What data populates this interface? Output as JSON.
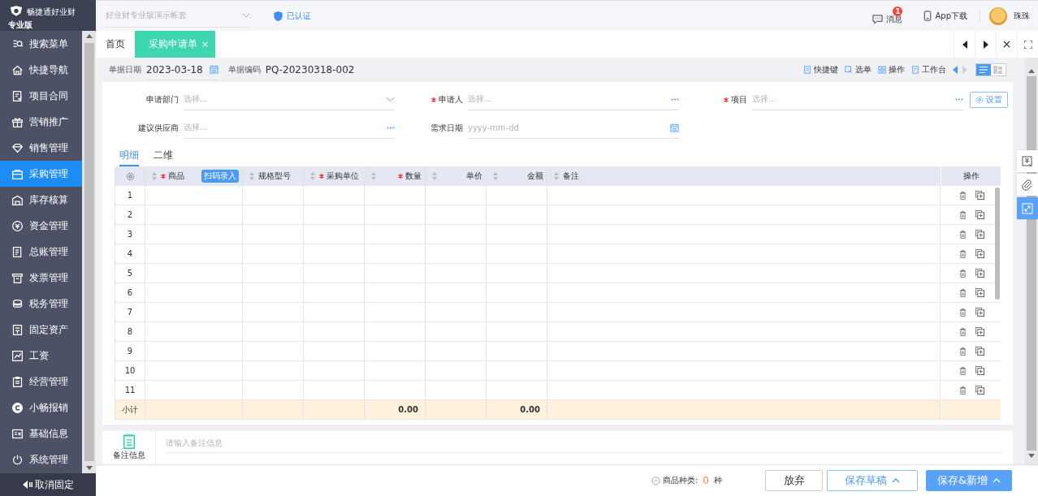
{
  "sidebar": {
    "brand": "畅捷通好业财",
    "edition": "专业版",
    "items": [
      {
        "label": "搜索菜单",
        "selected": false
      },
      {
        "label": "快捷导航",
        "selected": false
      },
      {
        "label": "项目合同",
        "selected": false
      },
      {
        "label": "营销推广",
        "selected": false
      },
      {
        "label": "销售管理",
        "selected": false
      },
      {
        "label": "采购管理",
        "selected": true
      },
      {
        "label": "库存核算",
        "selected": false
      },
      {
        "label": "资金管理",
        "selected": false
      },
      {
        "label": "总账管理",
        "selected": false
      },
      {
        "label": "发票管理",
        "selected": false
      },
      {
        "label": "税务管理",
        "selected": false
      },
      {
        "label": "固定资产",
        "selected": false
      },
      {
        "label": "工资",
        "selected": false
      },
      {
        "label": "经营管理",
        "selected": false
      },
      {
        "label": "小畅报销",
        "selected": false
      },
      {
        "label": "基础信息",
        "selected": false
      },
      {
        "label": "系统管理",
        "selected": false
      }
    ],
    "unpin": "取消固定"
  },
  "topbar": {
    "account_placeholder": "好业财专业版演示帐套",
    "certified": "已认证",
    "messages": {
      "label": "消息",
      "badge": "1"
    },
    "app_download": "App下载",
    "user": "珠珠"
  },
  "tabs": [
    {
      "label": "首页",
      "selected": false
    },
    {
      "label": "采购申请单",
      "selected": true,
      "close": "×"
    }
  ],
  "doc": {
    "date_label": "单据日期",
    "date": "2023-03-18",
    "code_label": "单据编码",
    "code": "PQ-20230318-002"
  },
  "toolbar": [
    {
      "label": "快捷键"
    },
    {
      "label": "选单"
    },
    {
      "label": "操作"
    },
    {
      "label": "工作台"
    }
  ],
  "views": [
    {
      "kind": "list",
      "selected": true
    },
    {
      "kind": "card",
      "selected": false
    }
  ],
  "form": {
    "fields": [
      {
        "label": "申请部门",
        "required": false,
        "placeholder": "选择...",
        "kind": "select"
      },
      {
        "label": "申请人",
        "required": true,
        "placeholder": "选择...",
        "kind": "lookup"
      },
      {
        "label": "项目",
        "required": true,
        "placeholder": "选择...",
        "kind": "lookup"
      },
      {
        "label": "建议供应商",
        "required": false,
        "placeholder": "选择...",
        "kind": "lookup"
      },
      {
        "label": "需求日期",
        "required": false,
        "placeholder": "yyyy-mm-dd",
        "kind": "date"
      }
    ],
    "settings": "设置"
  },
  "detail_tabs": [
    {
      "label": "明细",
      "selected": true
    },
    {
      "label": "二维",
      "selected": false
    }
  ],
  "table": {
    "columns": [
      {
        "label": "商品",
        "required": true
      },
      {
        "label": "规格型号",
        "required": false
      },
      {
        "label": "采购单位",
        "required": true
      },
      {
        "label": "数量",
        "required": true
      },
      {
        "label": "单价",
        "required": false
      },
      {
        "label": "金额",
        "required": false
      },
      {
        "label": "备注",
        "required": false
      }
    ],
    "scan_button": "扫码录入",
    "actions_heading": "操作",
    "rows": [
      "1",
      "2",
      "3",
      "4",
      "5",
      "6",
      "7",
      "8",
      "9",
      "10",
      "11"
    ],
    "subtotal": {
      "label": "小计",
      "quantity": "0.00",
      "amount": "0.00"
    }
  },
  "remark": {
    "label": "备注信息",
    "placeholder": "请输入备注信息"
  },
  "footer": {
    "summary_label": "商品种类:",
    "count": "0",
    "unit": "种",
    "buttons": [
      {
        "label": "放弃",
        "kind": "plain",
        "caret": false
      },
      {
        "label": "保存草稿",
        "kind": "outline",
        "caret": true
      },
      {
        "label": "保存&新增",
        "kind": "primary",
        "caret": true
      }
    ]
  }
}
